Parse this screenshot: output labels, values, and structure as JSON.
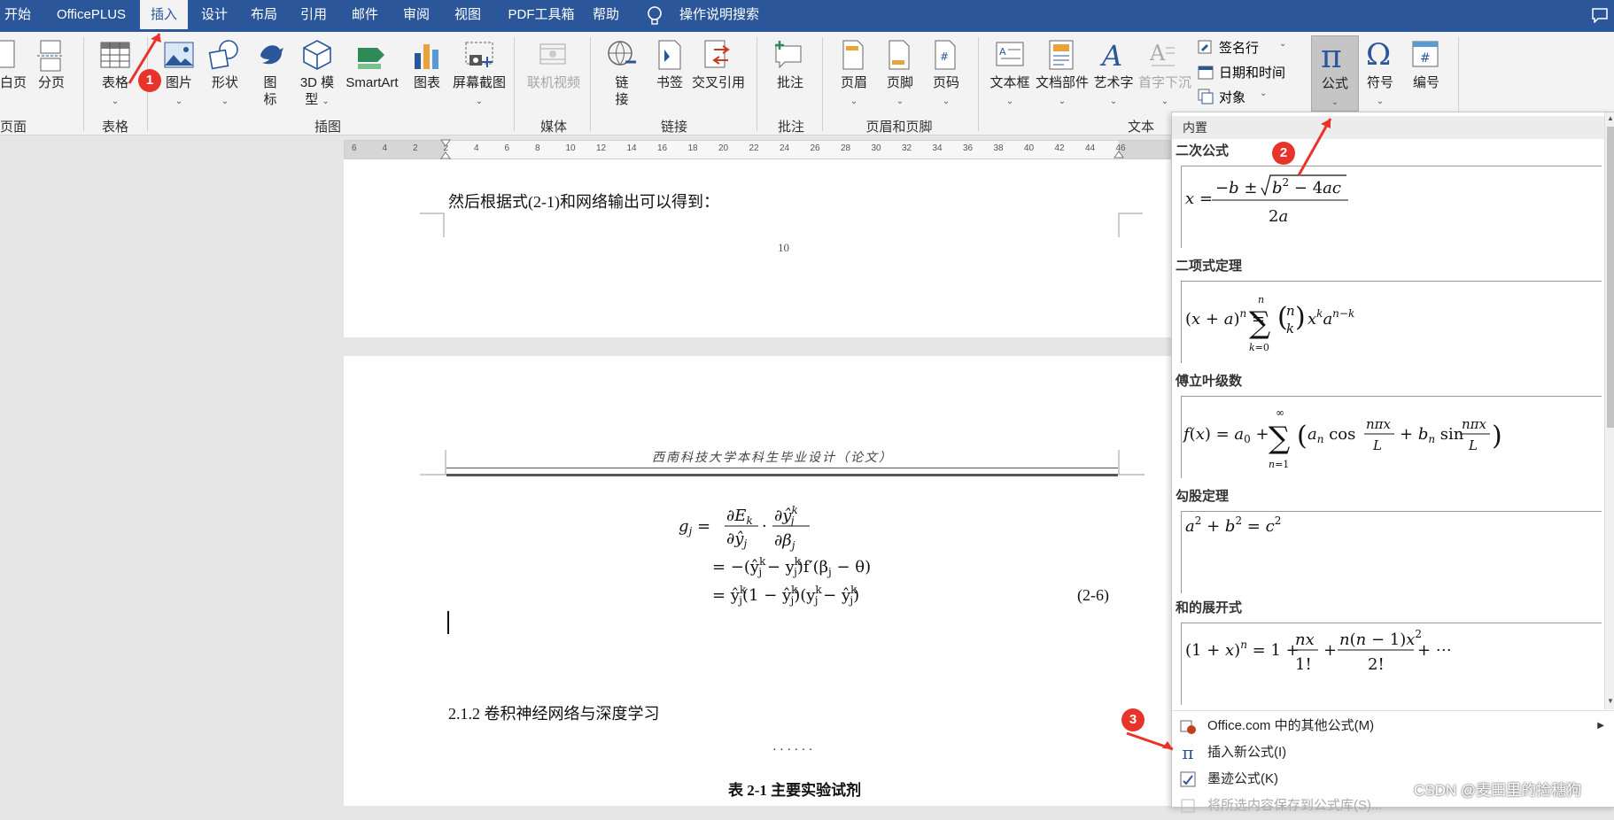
{
  "tabs": [
    "开始",
    "OfficePLUS",
    "插入",
    "设计",
    "布局",
    "引用",
    "邮件",
    "审阅",
    "视图",
    "PDF工具箱",
    "帮助",
    "操作说明搜索"
  ],
  "active_tab": "插入",
  "ribbon": {
    "pages_group": {
      "items": [
        "白页",
        "分页"
      ],
      "label": "页面"
    },
    "table_group": {
      "items": [
        "表格"
      ],
      "label": "表格"
    },
    "illustrations_group": {
      "items": [
        "图片",
        "形状",
        "图标",
        "3D 模型",
        "SmartArt",
        "图表",
        "屏幕截图"
      ],
      "label": "插图"
    },
    "media_group": {
      "items": [
        "联机视频"
      ],
      "label": "媒体"
    },
    "links_group": {
      "items": [
        "链接",
        "书签",
        "交叉引用"
      ],
      "label": "链接"
    },
    "comments_group": {
      "items": [
        "批注"
      ],
      "label": "批注"
    },
    "header_footer_group": {
      "items": [
        "页眉",
        "页脚",
        "页码"
      ],
      "label": "页眉和页脚"
    },
    "text_group": {
      "items": [
        "文本框",
        "文档部件",
        "艺术字",
        "首字下沉"
      ],
      "side": [
        "签名行",
        "日期和时间",
        "对象"
      ],
      "label": "文本"
    },
    "symbols_group": {
      "items": [
        "公式",
        "符号",
        "编号"
      ]
    }
  },
  "ruler": {
    "ticks": [
      "6",
      "4",
      "2",
      "2",
      "4",
      "6",
      "8",
      "10",
      "12",
      "14",
      "16",
      "18",
      "20",
      "22",
      "24",
      "26",
      "28",
      "30",
      "32",
      "34",
      "36",
      "38",
      "40",
      "42",
      "44",
      "46"
    ]
  },
  "document": {
    "line1": "然后根据式(2-1)和网络输出可以得到：",
    "page_number": "10",
    "header_text": "西南科技大学本科生毕业设计（论文）",
    "equation_number": "(2-6)",
    "section_heading": "2.1.2 卷积神经网络与深度学习",
    "dots": "· · · · · ·",
    "table_caption": "表 2-1  主要实验试剂"
  },
  "gallery": {
    "header": "内置",
    "items": [
      {
        "title": "二次公式",
        "formula": "x = (−b ± √(b² − 4ac)) / 2a"
      },
      {
        "title": "二项式定理",
        "formula": "(x + a)ⁿ = Σ(k=0..n) C(n,k) xᵏ aⁿ⁻ᵏ"
      },
      {
        "title": "傅立叶级数",
        "formula": "f(x) = a₀ + Σ(n=1..∞)(aₙ cos(nπx/L) + bₙ sin(nπx/L))"
      },
      {
        "title": "勾股定理",
        "formula": "a² + b² = c²"
      },
      {
        "title": "和的展开式",
        "formula": "(1 + x)ⁿ = 1 + nx/1! + n(n−1)x²/2! + ⋯"
      }
    ],
    "menu": [
      {
        "label": "Office.com 中的其他公式(M)",
        "icon": "office-icon"
      },
      {
        "label": "插入新公式(I)",
        "icon": "pi-icon"
      },
      {
        "label": "墨迹公式(K)",
        "icon": "ink-equation-icon"
      },
      {
        "label": "将所选内容保存到公式库(S)...",
        "icon": "save-icon"
      }
    ]
  },
  "annotations": [
    "1",
    "2",
    "3"
  ],
  "watermark": "CSDN @麦田里的捡穗狗",
  "colors": {
    "accent": "#2b579a",
    "badge": "#e8332a"
  }
}
